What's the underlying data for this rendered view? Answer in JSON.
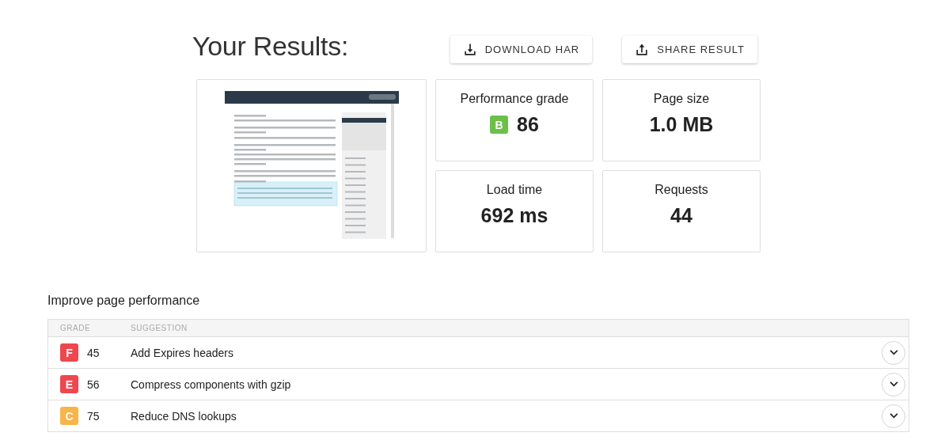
{
  "title": "Your Results:",
  "buttons": [
    {
      "label": "DOWNLOAD HAR",
      "kind": "download"
    },
    {
      "label": "SHARE RESULT",
      "kind": "share"
    }
  ],
  "metrics": [
    {
      "label": "Performance grade",
      "value": "86",
      "grade": {
        "letter": "B",
        "color": "#6cc04a"
      }
    },
    {
      "label": "Page size",
      "value": "1.0 MB"
    },
    {
      "label": "Load time",
      "value": "692 ms"
    },
    {
      "label": "Requests",
      "value": "44"
    }
  ],
  "improve": {
    "heading": "Improve page performance",
    "columns": [
      "GRADE",
      "SUGGESTION"
    ],
    "rows": [
      {
        "letter": "F",
        "color": "#f0474f",
        "score": "45",
        "suggestion": "Add Expires headers",
        "expanded": false
      },
      {
        "letter": "E",
        "color": "#f0474f",
        "score": "56",
        "suggestion": "Compress components with gzip",
        "expanded": false
      },
      {
        "letter": "C",
        "color": "#f9b44a",
        "score": "75",
        "suggestion": "Reduce DNS lookups",
        "expanded": false
      }
    ]
  }
}
